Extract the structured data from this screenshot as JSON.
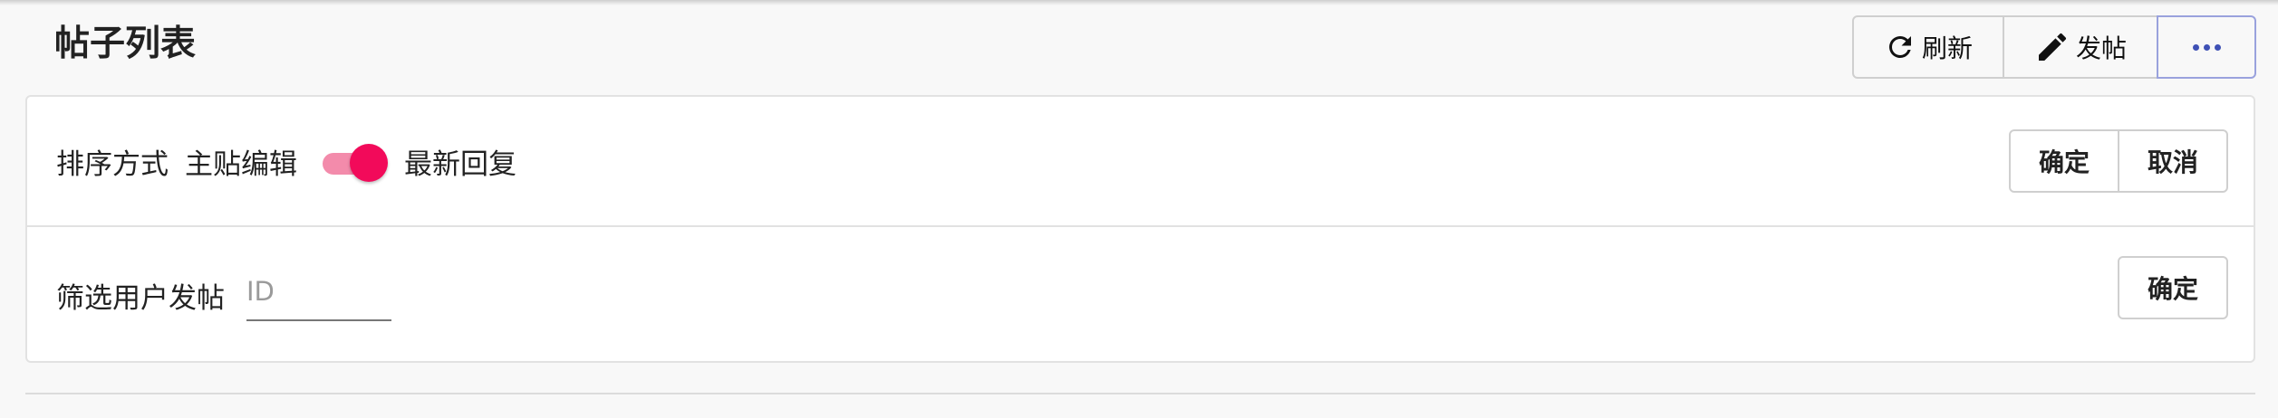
{
  "header": {
    "title": "帖子列表",
    "refresh_label": "刷新",
    "post_label": "发帖",
    "more_label": "•••"
  },
  "sort": {
    "label": "排序方式",
    "option_left": "主贴编辑",
    "option_right": "最新回复",
    "toggle_on": true,
    "confirm_label": "确定",
    "cancel_label": "取消"
  },
  "filter": {
    "label": "筛选用户发帖",
    "input_value": "",
    "input_placeholder": "ID",
    "confirm_label": "确定"
  },
  "colors": {
    "switch_knob": "#f20a5a",
    "switch_track": "#f38bab",
    "more_accent": "#3f51b5"
  }
}
